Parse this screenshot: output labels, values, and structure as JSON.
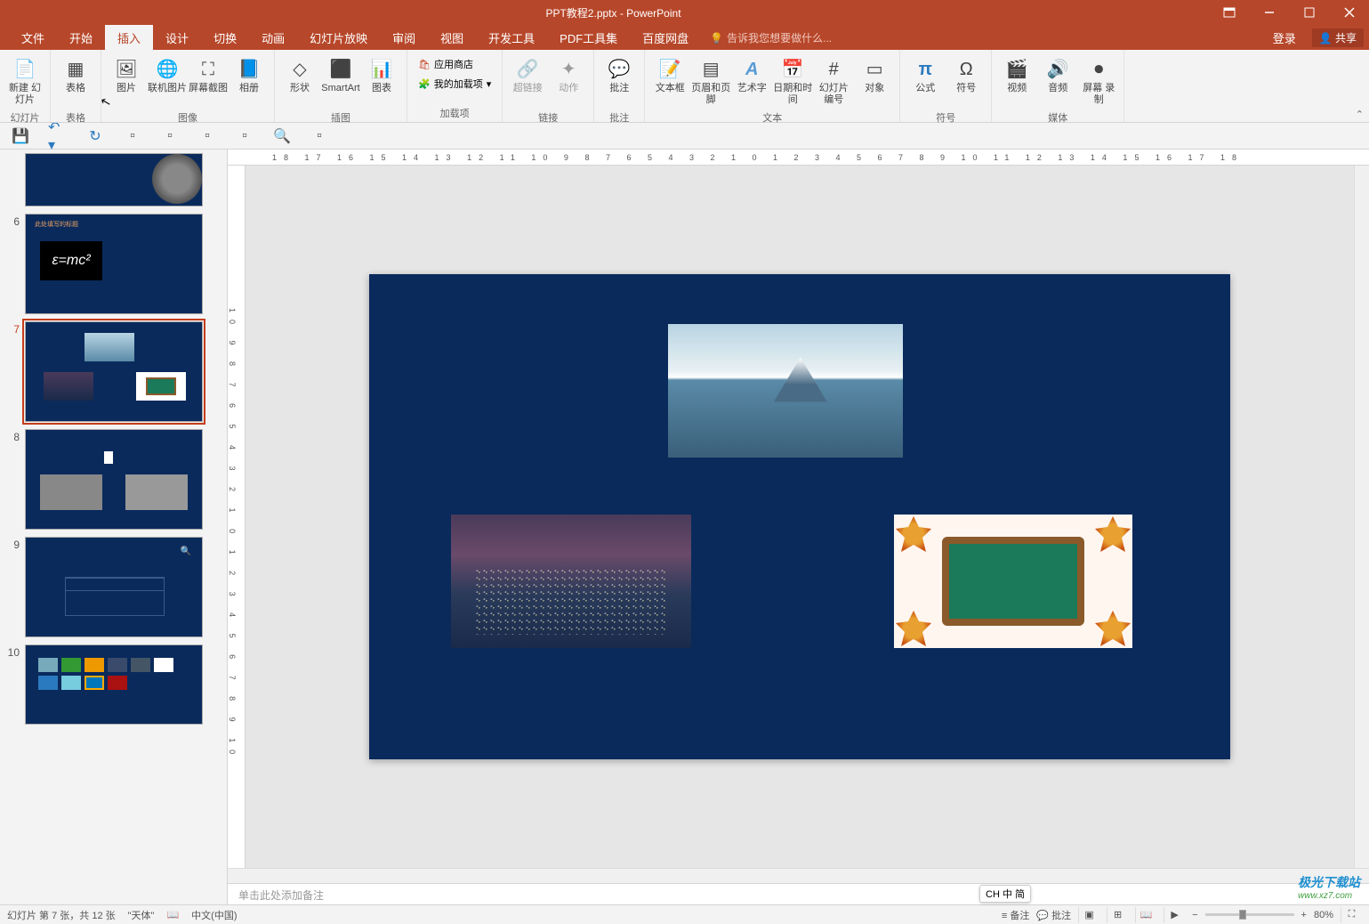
{
  "title": "PPT教程2.pptx - PowerPoint",
  "menu": {
    "file": "文件",
    "home": "开始",
    "insert": "插入",
    "design": "设计",
    "transition": "切换",
    "animation": "动画",
    "slideshow": "幻灯片放映",
    "review": "审阅",
    "view": "视图",
    "devtools": "开发工具",
    "pdf": "PDF工具集",
    "baidu": "百度网盘",
    "tellme": "告诉我您想要做什么...",
    "login": "登录",
    "share": "共享"
  },
  "ribbon": {
    "newslide": "新建\n幻灯片",
    "slides_grp": "幻灯片",
    "table": "表格",
    "tables_grp": "表格",
    "picture": "图片",
    "online_pic": "联机图片",
    "screenshot": "屏幕截图",
    "album": "相册",
    "images_grp": "图像",
    "shapes": "形状",
    "smartart": "SmartArt",
    "chart": "图表",
    "illus_grp": "插图",
    "store": "应用商店",
    "myaddins": "我的加载项",
    "addins_grp": "加载项",
    "hyperlink": "超链接",
    "action": "动作",
    "links_grp": "链接",
    "comment": "批注",
    "comment_grp": "批注",
    "textbox": "文本框",
    "headerfooter": "页眉和页脚",
    "wordart": "艺术字",
    "datetime": "日期和时间",
    "slidenum": "幻灯片\n编号",
    "object": "对象",
    "text_grp": "文本",
    "equation": "公式",
    "symbol": "符号",
    "symbols_grp": "符号",
    "video": "视频",
    "audio": "音频",
    "screenrec": "屏幕\n录制",
    "media_grp": "媒体"
  },
  "ruler_marks": "18 17 16 15 14 13 12 11 10 9 8 7 6 5 4 3 2 1 0 1 2 3 4 5 6 7 8 9 10 11 12 13 14 15 16 17 18",
  "vruler_marks": "10 9 8 7 6 5 4 3 2 1 0 1 2 3 4 5 6 7 8 9 10",
  "thumbs": {
    "n6": "6",
    "n7": "7",
    "n8": "8",
    "n9": "9",
    "n10": "10",
    "slide6_title": "此处填写的标题",
    "emc": "ε=mc²"
  },
  "notes_placeholder": "单击此处添加备注",
  "status": {
    "slide_info": "幻灯片 第 7 张，共 12 张",
    "theme": "\"天体\"",
    "lang": "中文(中国)",
    "ime": "CH 中 简",
    "notes_btn": "备注",
    "comments_btn": "批注",
    "zoom": "80%"
  },
  "watermark": {
    "line1": "极光下载站",
    "line2": "www.xz7.com"
  }
}
